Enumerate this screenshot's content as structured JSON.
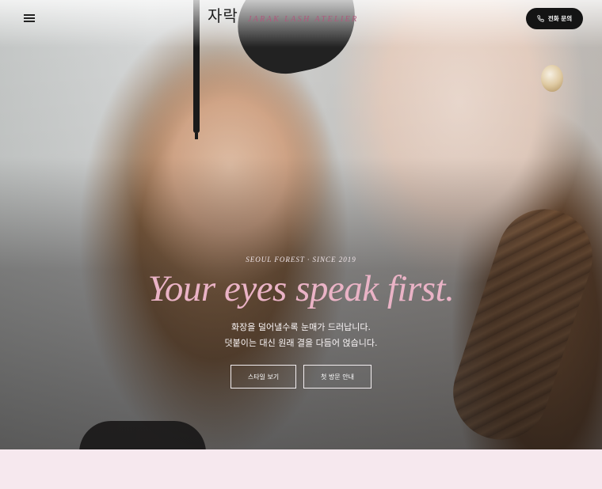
{
  "header": {
    "brand_korean": "자락",
    "brand_english": "JARAK LASH ATELIER",
    "menu_icon": "hamburger-menu-icon",
    "call_button": {
      "icon": "phone-icon",
      "label": "전화 문의"
    }
  },
  "hero": {
    "eyebrow": "SEOUL FOREST · SINCE 2019",
    "headline": "Your eyes speak first.",
    "subtitle_line1": "화장을 덜어낼수록 눈매가 드러납니다.",
    "subtitle_line2": "덧붙이는 대신 원래 결을 다듬어 얹습니다.",
    "buttons": [
      {
        "label": "스타일 보기"
      },
      {
        "label": "첫 방문 안내"
      }
    ]
  },
  "colors": {
    "accent_pink": "#eab3c6",
    "brand_rose": "#b0587d",
    "button_dark": "#141414",
    "section_bg": "#f6e8ee"
  }
}
